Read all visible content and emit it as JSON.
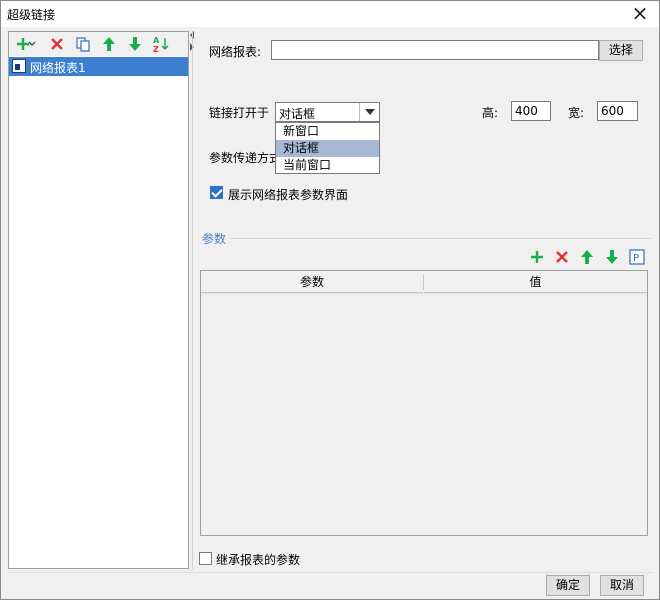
{
  "window": {
    "title": "超级链接"
  },
  "left_toolbar": {
    "icons": [
      "add-icon",
      "delete-icon",
      "copy-icon",
      "move-up-icon",
      "move-down-icon",
      "sort-icon"
    ]
  },
  "tree": {
    "items": [
      {
        "label": "网络报表1",
        "selected": true
      }
    ]
  },
  "form": {
    "report_label": "网络报表:",
    "report_value": "",
    "select_button": "选择",
    "open_in_label": "链接打开于",
    "open_in_value": "对话框",
    "open_in_options": [
      "新窗口",
      "对话框",
      "当前窗口"
    ],
    "height_label": "高:",
    "height_value": "400",
    "width_label": "宽:",
    "width_value": "600",
    "param_pass_label": "参数传递方式",
    "show_params_label": "展示网络报表参数界面",
    "show_params_checked": true
  },
  "params": {
    "group_title": "参数",
    "columns": [
      "参数",
      "值"
    ],
    "rows": [],
    "toolbar_icons": [
      "add-icon",
      "delete-icon",
      "move-up-icon",
      "move-down-icon",
      "parameter-icon"
    ],
    "param_icon_text": "P"
  },
  "inherit_label": "继承报表的参数",
  "inherit_checked": false,
  "buttons": {
    "ok": "确定",
    "cancel": "取消"
  },
  "colors": {
    "accent": "#3d7fcf",
    "add": "#1aae4b",
    "delete": "#e23030",
    "group_title": "#4a7fc4"
  }
}
